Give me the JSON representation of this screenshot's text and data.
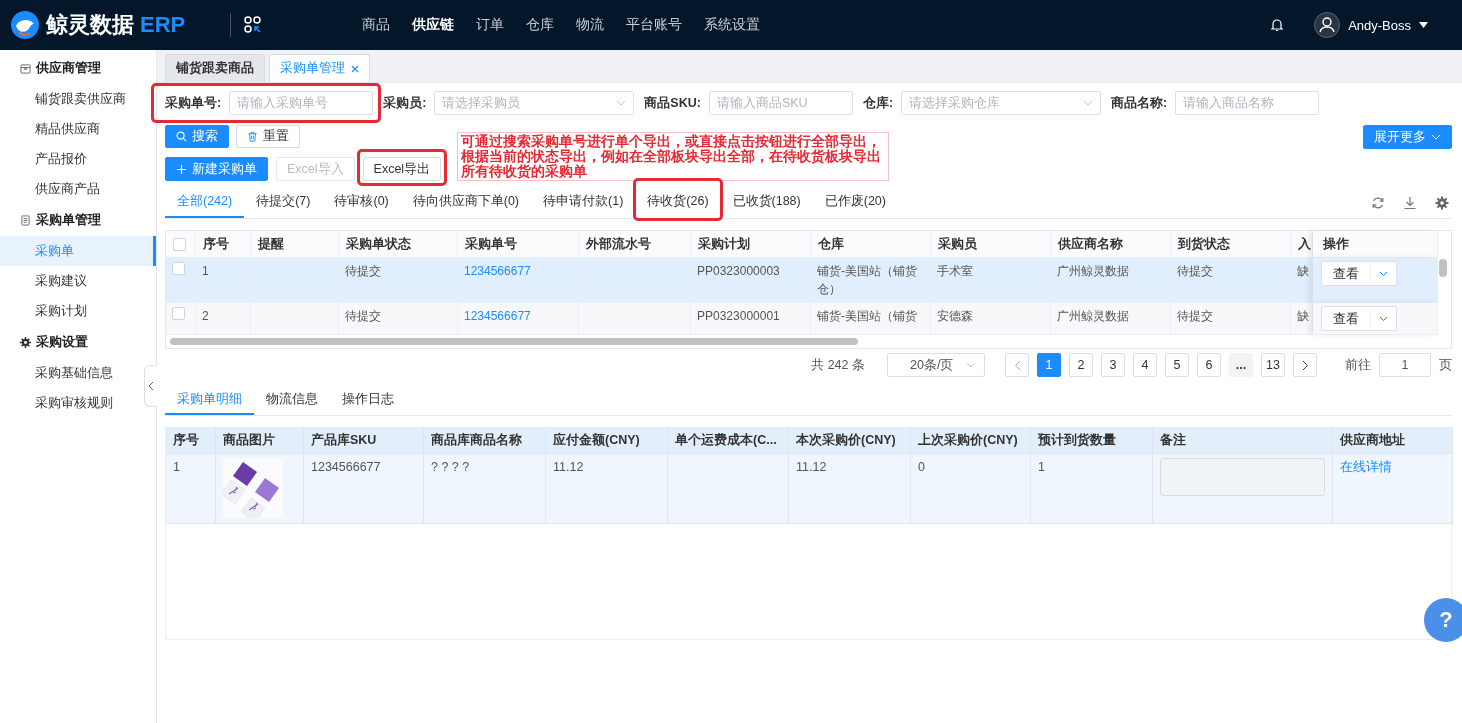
{
  "topbar": {
    "logo": "鲸灵数据",
    "logo_suffix": "ERP",
    "nav": [
      {
        "label": "商品",
        "selected": false
      },
      {
        "label": "供应链",
        "selected": true
      },
      {
        "label": "订单",
        "selected": false
      },
      {
        "label": "仓库",
        "selected": false
      },
      {
        "label": "物流",
        "selected": false
      },
      {
        "label": "平台账号",
        "selected": false
      },
      {
        "label": "系统设置",
        "selected": false
      }
    ],
    "user": "Andy-Boss"
  },
  "sidebar": {
    "groups": [
      {
        "label": "供应商管理",
        "kind": "supplier",
        "items": [
          {
            "label": "铺货跟卖供应商",
            "selected": false
          },
          {
            "label": "精品供应商",
            "selected": false
          },
          {
            "label": "产品报价",
            "selected": false
          },
          {
            "label": "供应商产品",
            "selected": false
          }
        ]
      },
      {
        "label": "采购单管理",
        "kind": "orders",
        "items": [
          {
            "label": "采购单",
            "selected": true
          },
          {
            "label": "采购建议",
            "selected": false
          },
          {
            "label": "采购计划",
            "selected": false
          }
        ]
      },
      {
        "label": "采购设置",
        "kind": "settings",
        "items": [
          {
            "label": "采购基础信息",
            "selected": false
          },
          {
            "label": "采购审核规则",
            "selected": false
          }
        ]
      }
    ]
  },
  "page_tabs": [
    {
      "label": "铺货跟卖商品",
      "selected": false,
      "closable": false
    },
    {
      "label": "采购单管理",
      "selected": true,
      "closable": true
    }
  ],
  "filters": [
    {
      "label": "采购单号:",
      "kind": "input",
      "placeholder": "请输入采购单号",
      "highlighted": true
    },
    {
      "label": "采购员:",
      "kind": "select",
      "placeholder": "请选择采购员",
      "highlighted": false
    },
    {
      "label": "商品SKU:",
      "kind": "input",
      "placeholder": "请输入商品SKU",
      "highlighted": false
    },
    {
      "label": "仓库:",
      "kind": "select",
      "placeholder": "请选择采购仓库",
      "highlighted": false
    },
    {
      "label": "商品名称:",
      "kind": "input",
      "placeholder": "请输入商品名称",
      "highlighted": false
    }
  ],
  "search_buttons": [
    {
      "label": "搜索",
      "kind": "search"
    },
    {
      "label": "重置",
      "kind": "reset"
    }
  ],
  "expand_button": "展开更多",
  "actions": [
    {
      "label": "新建采购单",
      "kind": "create",
      "disabled": false,
      "highlighted": false
    },
    {
      "label": "Excel导入",
      "kind": "default",
      "disabled": true,
      "highlighted": false
    },
    {
      "label": "Excel导出",
      "kind": "default",
      "disabled": false,
      "highlighted": true
    }
  ],
  "note": "可通过搜索采购单号进行单个导出，或直接点击按钮进行全部导出，根据当前的状态导出，例如在全部板块导出全部，在待收货板块导出所有待收货的采购单",
  "status_tabs": [
    {
      "label": "全部(242)",
      "selected": true,
      "highlighted": false
    },
    {
      "label": "待提交(7)",
      "selected": false,
      "highlighted": false
    },
    {
      "label": "待审核(0)",
      "selected": false,
      "highlighted": false
    },
    {
      "label": "待向供应商下单(0)",
      "selected": false,
      "highlighted": false
    },
    {
      "label": "待申请付款(1)",
      "selected": false,
      "highlighted": false
    },
    {
      "label": "待收货(26)",
      "selected": false,
      "highlighted": true
    },
    {
      "label": "已收货(188)",
      "selected": false,
      "highlighted": false
    },
    {
      "label": "已作废(20)",
      "selected": false,
      "highlighted": false
    }
  ],
  "table": {
    "columns": [
      {
        "label": "序号",
        "kind": "text"
      },
      {
        "label": "提醒",
        "kind": "text"
      },
      {
        "label": "采购单状态",
        "kind": "text"
      },
      {
        "label": "采购单号",
        "kind": "link"
      },
      {
        "label": "外部流水号",
        "kind": "text"
      },
      {
        "label": "采购计划",
        "kind": "text"
      },
      {
        "label": "仓库",
        "kind": "text"
      },
      {
        "label": "采购员",
        "kind": "text"
      },
      {
        "label": "供应商名称",
        "kind": "text"
      },
      {
        "label": "到货状态",
        "kind": "text"
      },
      {
        "label": "入",
        "kind": "text"
      }
    ],
    "action_column": "操作",
    "all_checked": false,
    "rows": [
      {
        "selected": true,
        "checked": false,
        "cells": [
          "1",
          null,
          "待提交",
          "1234566677",
          null,
          "PP0323000003",
          "铺货-美国站（铺货仓）",
          "手术室",
          "广州鲸灵数据",
          "待提交",
          "缺"
        ],
        "action": "查看"
      },
      {
        "selected": false,
        "checked": false,
        "cells": [
          "2",
          null,
          "待提交",
          "1234566677",
          null,
          "PP0323000001",
          "铺货-美国站（铺货",
          "安德森",
          "广州鲸灵数据",
          "待提交",
          "缺"
        ],
        "action": "查看"
      }
    ]
  },
  "pagination": {
    "total": "共 242 条",
    "page_size": "20条/页",
    "pages": [
      {
        "label": "1",
        "kind": "page",
        "selected": true
      },
      {
        "label": "2",
        "kind": "page",
        "selected": false
      },
      {
        "label": "3",
        "kind": "page",
        "selected": false
      },
      {
        "label": "4",
        "kind": "page",
        "selected": false
      },
      {
        "label": "5",
        "kind": "page",
        "selected": false
      },
      {
        "label": "6",
        "kind": "page",
        "selected": false
      },
      {
        "label": "...",
        "kind": "more",
        "selected": false
      },
      {
        "label": "13",
        "kind": "page",
        "selected": false
      }
    ],
    "goto_label": "前往",
    "goto_value": "1",
    "goto_suffix": "页"
  },
  "detail_tabs": [
    {
      "label": "采购单明细",
      "selected": true
    },
    {
      "label": "物流信息",
      "selected": false
    },
    {
      "label": "操作日志",
      "selected": false
    }
  ],
  "detail_table": {
    "columns": [
      {
        "label": "序号",
        "kind": "text"
      },
      {
        "label": "商品图片",
        "kind": "picture"
      },
      {
        "label": "产品库SKU",
        "kind": "text"
      },
      {
        "label": "商品库商品名称",
        "kind": "text"
      },
      {
        "label": "应付金额(CNY)",
        "kind": "text"
      },
      {
        "label": "单个运费成本(C...",
        "kind": "text"
      },
      {
        "label": "本次采购价(CNY)",
        "kind": "text"
      },
      {
        "label": "上次采购价(CNY)",
        "kind": "text"
      },
      {
        "label": "预计到货数量",
        "kind": "text"
      },
      {
        "label": "备注",
        "kind": "textarea"
      },
      {
        "label": "供应商地址",
        "kind": "link"
      }
    ],
    "rows": [
      {
        "cells": [
          "1",
          null,
          "1234566677",
          "? ? ? ?",
          "11.12",
          null,
          "11.12",
          "0",
          "1",
          null,
          "在线详情"
        ]
      }
    ]
  },
  "help_button": "?"
}
